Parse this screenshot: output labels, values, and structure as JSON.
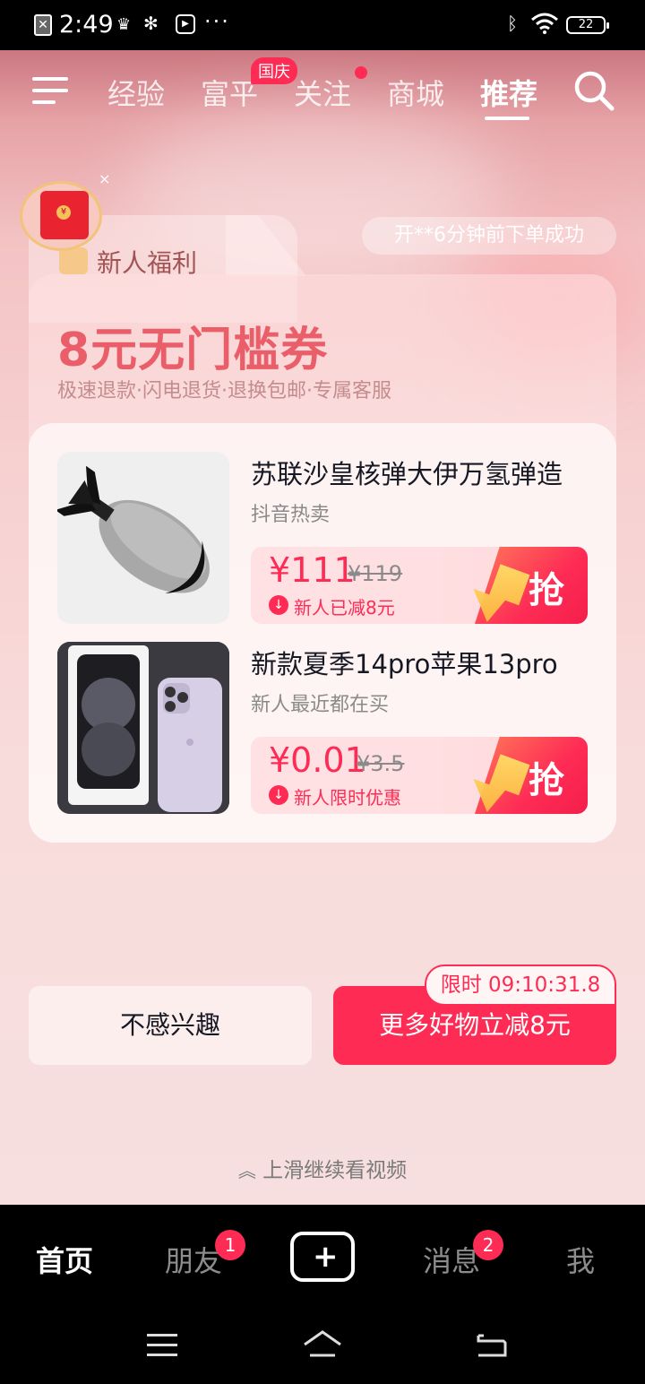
{
  "status": {
    "time": "2:49",
    "battery": "22",
    "dots": "···"
  },
  "nav": {
    "tabs": [
      "经验",
      "富平",
      "关注",
      "商城",
      "推荐"
    ],
    "active": "推荐",
    "badge": "国庆"
  },
  "promo": {
    "title": "新人福利",
    "order_notice": "开**6分钟前下单成功",
    "coupon": "8元无门槛券",
    "perks": "极速退款·闪电退货·退换包邮·专属客服",
    "close": "×"
  },
  "products": [
    {
      "title": "苏联沙皇核弹大伊万氢弹造",
      "subtitle": "抖音热卖",
      "price": "¥111",
      "old_price": "¥119",
      "discount": "新人已减8元",
      "grab": "抢"
    },
    {
      "title": "新款夏季14pro苹果13pro",
      "subtitle": "新人最近都在买",
      "price": "¥0.01",
      "old_price": "¥3.5",
      "discount": "新人限时优惠",
      "grab": "抢"
    }
  ],
  "actions": {
    "not_interested": "不感兴趣",
    "more": "更多好物立减8元",
    "timer": "限时 09:10:31.8"
  },
  "swipe_hint": "上滑继续看视频",
  "bottom_nav": {
    "home": "首页",
    "friends": "朋友",
    "friends_badge": "1",
    "messages": "消息",
    "messages_badge": "2",
    "me": "我"
  },
  "colors": {
    "accent": "#fe2c55",
    "coupon": "#ea5e6a"
  }
}
